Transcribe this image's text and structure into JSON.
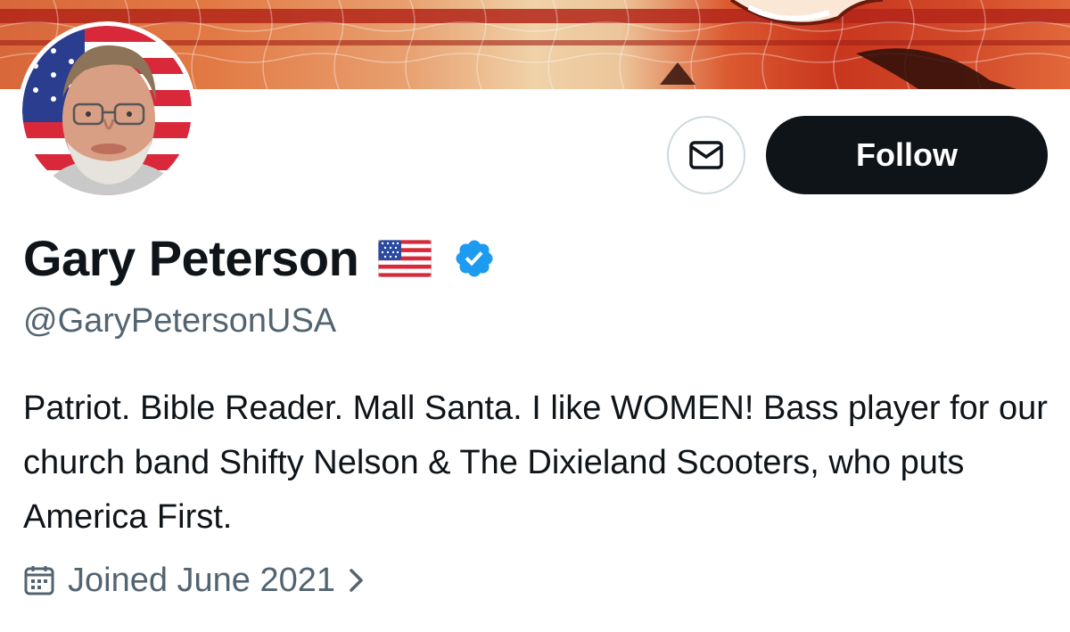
{
  "profile": {
    "display_name": "Gary Peterson",
    "handle": "@GaryPetersonUSA",
    "bio": "Patriot. Bible Reader. Mall Santa. I like WOMEN! Bass player for our church band Shifty Nelson & The Dixieland Scooters, who puts America First.",
    "joined": "Joined June 2021",
    "verified": true
  },
  "actions": {
    "follow_label": "Follow"
  },
  "icons": {
    "message": "envelope-icon",
    "verified": "verified-badge-icon",
    "flag": "us-flag-emoji",
    "calendar": "calendar-icon",
    "chevron": "chevron-right-icon"
  },
  "colors": {
    "text_primary": "#0f1419",
    "text_secondary": "#536471",
    "verified_blue": "#1d9bf0",
    "button_dark": "#0f1419"
  }
}
